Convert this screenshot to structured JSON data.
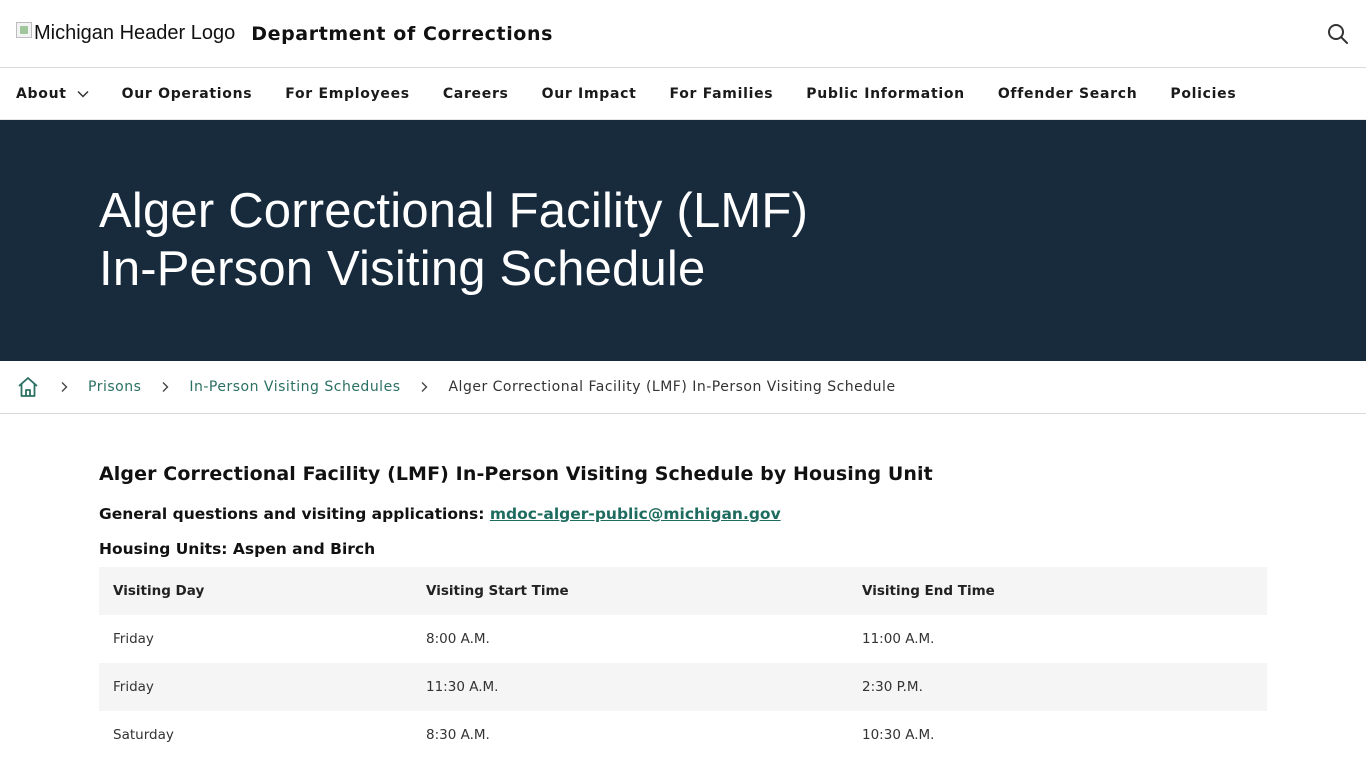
{
  "header": {
    "logo_alt": "Michigan Header Logo",
    "site_title": "Department of Corrections"
  },
  "nav": {
    "items": [
      {
        "label": "About"
      },
      {
        "label": "Our Operations"
      },
      {
        "label": "For Employees"
      },
      {
        "label": "Careers"
      },
      {
        "label": "Our Impact"
      },
      {
        "label": "For Families"
      },
      {
        "label": "Public Information"
      },
      {
        "label": "Offender Search"
      },
      {
        "label": "Policies"
      }
    ]
  },
  "hero": {
    "title_line1": "Alger Correctional Facility (LMF)",
    "title_line2": "In-Person Visiting Schedule",
    "background": "#172b3d"
  },
  "breadcrumb": {
    "items": [
      {
        "label": "Prisons"
      },
      {
        "label": "In-Person Visiting Schedules"
      },
      {
        "label": "Alger Correctional Facility (LMF) In-Person Visiting Schedule"
      }
    ]
  },
  "content": {
    "heading": "Alger Correctional Facility (LMF) In-Person Visiting Schedule by Housing Unit",
    "questions_label": "General questions and visiting applications:",
    "email": "mdoc-alger-public@michigan.gov",
    "housing_units": "Housing Units: Aspen and Birch",
    "table": {
      "headers": [
        "Visiting Day",
        "Visiting Start Time",
        "Visiting End Time"
      ],
      "rows": [
        [
          "Friday",
          "8:00 A.M.",
          "11:00 A.M."
        ],
        [
          "Friday",
          "11:30 A.M.",
          "2:30 P.M."
        ],
        [
          "Saturday",
          "8:30 A.M.",
          "10:30 A.M."
        ]
      ]
    }
  },
  "colors": {
    "link": "#2a7063",
    "hero_bg": "#172b3d"
  }
}
